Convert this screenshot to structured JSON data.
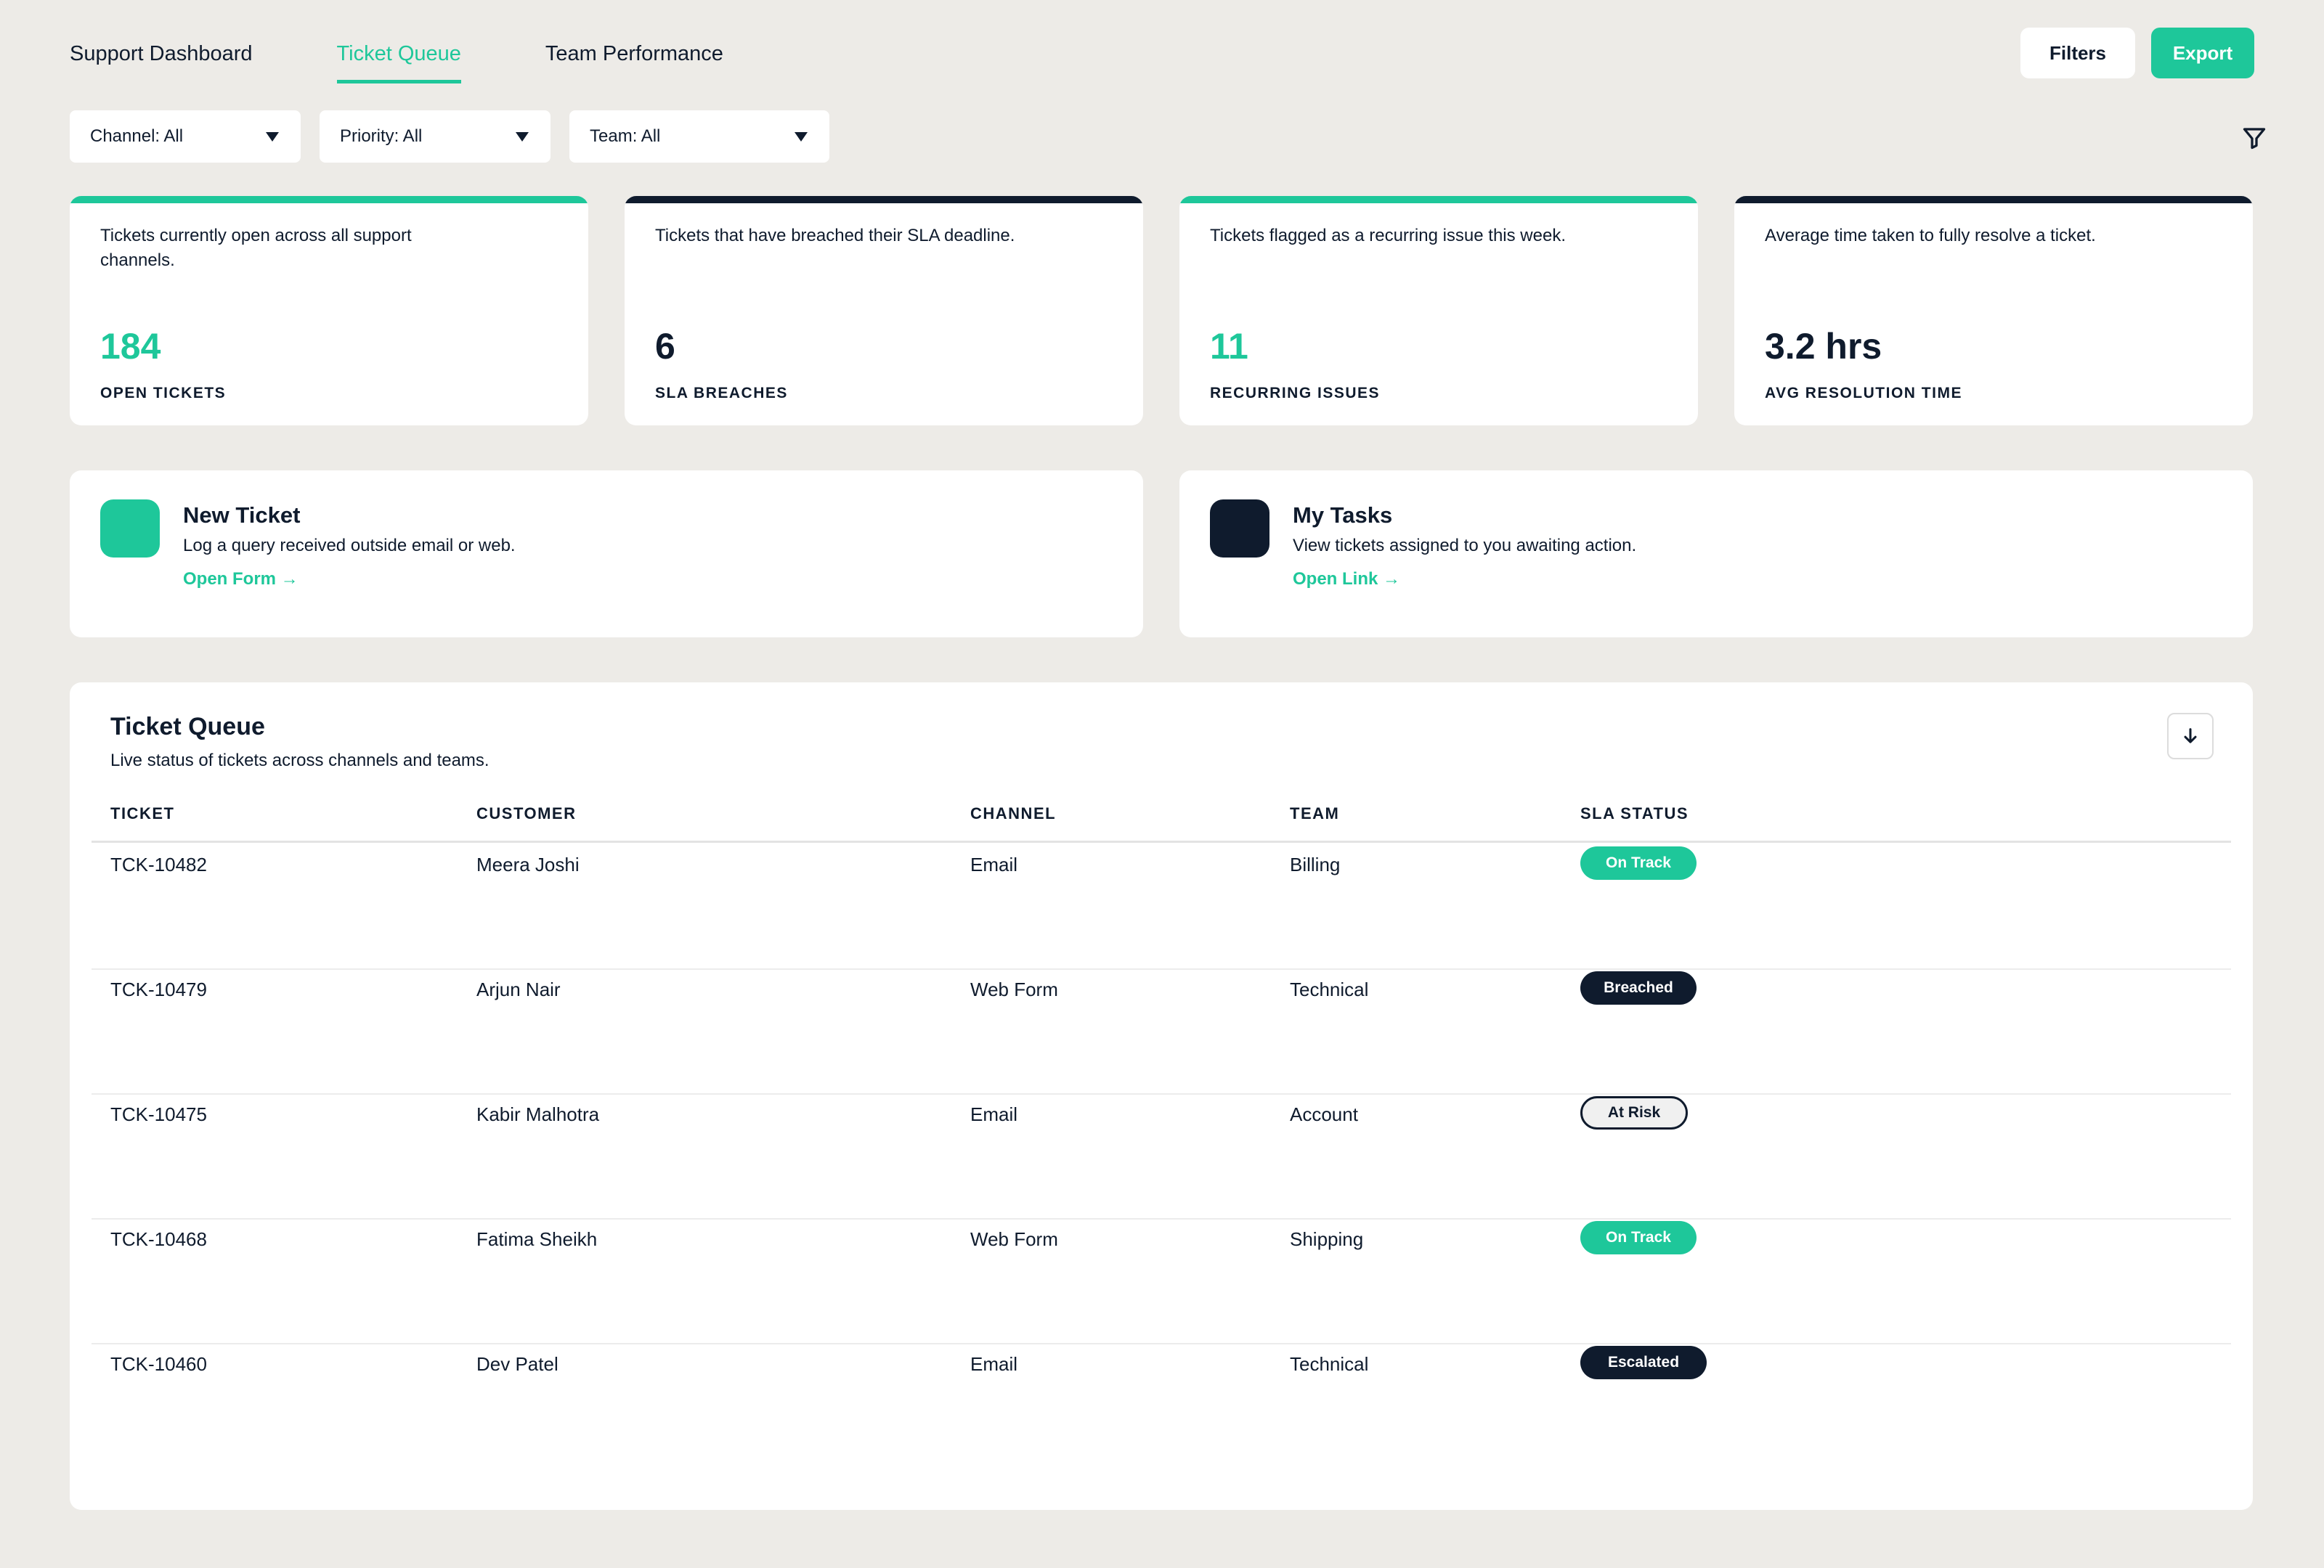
{
  "nav": {
    "tabs": [
      {
        "label": "Support Dashboard",
        "active": false
      },
      {
        "label": "Ticket Queue",
        "active": true
      },
      {
        "label": "Team Performance",
        "active": false
      }
    ]
  },
  "toolbar": {
    "filters_label": "Filters",
    "export_label": "Export"
  },
  "filters": [
    {
      "label": "Channel: All"
    },
    {
      "label": "Priority: All"
    },
    {
      "label": "Team: All"
    }
  ],
  "filter_icon": "funnel-icon",
  "stats": [
    {
      "desc": "Tickets currently open across all support channels.",
      "value": "184",
      "label": "OPEN TICKETS",
      "accent": "#1ec79a"
    },
    {
      "desc": "Tickets that have breached their SLA deadline.",
      "value": "6",
      "label": "SLA BREACHES",
      "accent": "#0f1b2d"
    },
    {
      "desc": "Tickets flagged as a recurring issue this week.",
      "value": "11",
      "label": "RECURRING ISSUES",
      "accent": "#1ec79a"
    },
    {
      "desc": "Average time taken to fully resolve a ticket.",
      "value": "3.2 hrs",
      "label": "AVG RESOLUTION TIME",
      "accent": "#0f1b2d"
    }
  ],
  "quick_actions": [
    {
      "title": "New Ticket",
      "sub": "Log a query received outside email or web.",
      "link": "Open Form →",
      "color": "#1ec79a"
    },
    {
      "title": "My Tasks",
      "sub": "View tickets assigned to you awaiting action.",
      "link": "Open Link →",
      "color": "#0f1b2d"
    }
  ],
  "queue": {
    "title": "Ticket Queue",
    "subtitle": "Live status of tickets across channels and teams.",
    "download_icon": "arrow-down-icon",
    "columns": [
      "TICKET",
      "CUSTOMER",
      "CHANNEL",
      "TEAM",
      "SLA STATUS"
    ],
    "rows": [
      {
        "ticket": "TCK-10482",
        "customer": "Meera Joshi",
        "channel": "Email",
        "team": "Billing",
        "status": "On Track",
        "status_style": "green"
      },
      {
        "ticket": "TCK-10479",
        "customer": "Arjun Nair",
        "channel": "Web Form",
        "team": "Technical",
        "status": "Breached",
        "status_style": "dark"
      },
      {
        "ticket": "TCK-10475",
        "customer": "Kabir Malhotra",
        "channel": "Email",
        "team": "Account",
        "status": "At Risk",
        "status_style": "outline"
      },
      {
        "ticket": "TCK-10468",
        "customer": "Fatima Sheikh",
        "channel": "Web Form",
        "team": "Shipping",
        "status": "On Track",
        "status_style": "green"
      },
      {
        "ticket": "TCK-10460",
        "customer": "Dev Patel",
        "channel": "Email",
        "team": "Technical",
        "status": "Escalated",
        "status_style": "dark"
      }
    ]
  },
  "colors": {
    "accent": "#1ec79a",
    "dark": "#0f1b2d",
    "background": "#edebe7"
  }
}
